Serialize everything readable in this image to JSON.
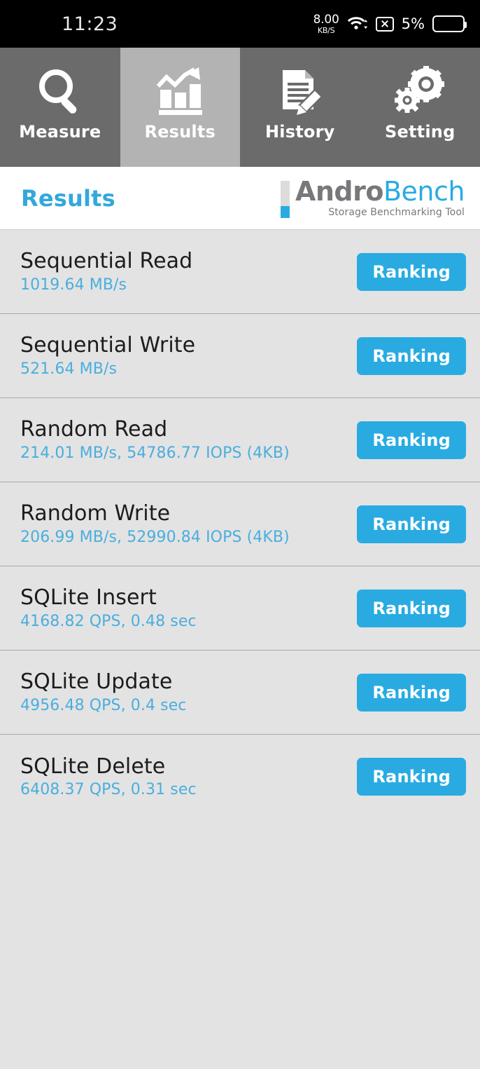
{
  "status_bar": {
    "clock": "11:23",
    "network_speed_value": "8.00",
    "network_speed_unit": "KB/S",
    "wifi_icon": "wifi-icon",
    "sim_icon": "sim-no-service-icon",
    "battery_percent": "5%",
    "battery_level": 5,
    "battery_color": "#e33030"
  },
  "tabs": [
    {
      "label": "Measure",
      "icon": "magnifier-icon",
      "active": false
    },
    {
      "label": "Results",
      "icon": "bar-chart-icon",
      "active": true
    },
    {
      "label": "History",
      "icon": "document-pencil-icon",
      "active": false
    },
    {
      "label": "Setting",
      "icon": "gears-icon",
      "active": false
    }
  ],
  "header": {
    "page_title": "Results",
    "brand_first": "Andro",
    "brand_second": "Bench",
    "brand_tagline": "Storage Benchmarking Tool"
  },
  "colors": {
    "accent_blue": "#29abe2",
    "value_blue": "#4aaede",
    "tab_inactive": "#6b6b6b",
    "tab_active": "#b3b3b3",
    "page_background": "#e3e3e3",
    "brand_gray": "#77787b"
  },
  "results": {
    "ranking_label": "Ranking",
    "rows": [
      {
        "title": "Sequential Read",
        "value": "1019.64 MB/s"
      },
      {
        "title": "Sequential Write",
        "value": "521.64 MB/s"
      },
      {
        "title": "Random Read",
        "value": "214.01 MB/s, 54786.77 IOPS (4KB)"
      },
      {
        "title": "Random Write",
        "value": "206.99 MB/s, 52990.84 IOPS (4KB)"
      },
      {
        "title": "SQLite Insert",
        "value": "4168.82 QPS, 0.48 sec"
      },
      {
        "title": "SQLite Update",
        "value": "4956.48 QPS, 0.4 sec"
      },
      {
        "title": "SQLite Delete",
        "value": "6408.37 QPS, 0.31 sec"
      }
    ]
  }
}
